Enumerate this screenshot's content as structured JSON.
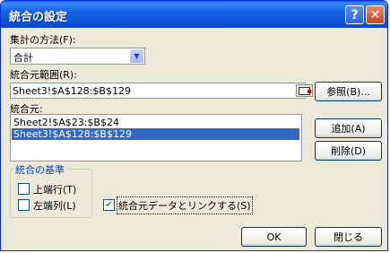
{
  "window": {
    "title": "統合の設定",
    "help_label": "?",
    "close_label": "✕"
  },
  "function": {
    "label": "集計の方法(F):",
    "value": "合計"
  },
  "reference": {
    "label": "統合元範囲(R):",
    "value": "Sheet3!$A$128:$B$129",
    "browse_label": "参照(B)..."
  },
  "sources": {
    "label": "統合元:",
    "items": [
      {
        "text": "Sheet2!$A$23:$B$24",
        "selected": false
      },
      {
        "text": "Sheet3!$A$128:$B$129",
        "selected": true
      }
    ],
    "add_label": "追加(A)",
    "delete_label": "削除(D)"
  },
  "labels_group": {
    "title": "統合の基準",
    "top_row": {
      "label": "上端行(T)",
      "checked": false
    },
    "left_column": {
      "label": "左端列(L)",
      "checked": false
    }
  },
  "link": {
    "label": "統合元データとリンクする(S)",
    "checked": true
  },
  "footer": {
    "ok_label": "OK",
    "close_label": "閉じる"
  }
}
